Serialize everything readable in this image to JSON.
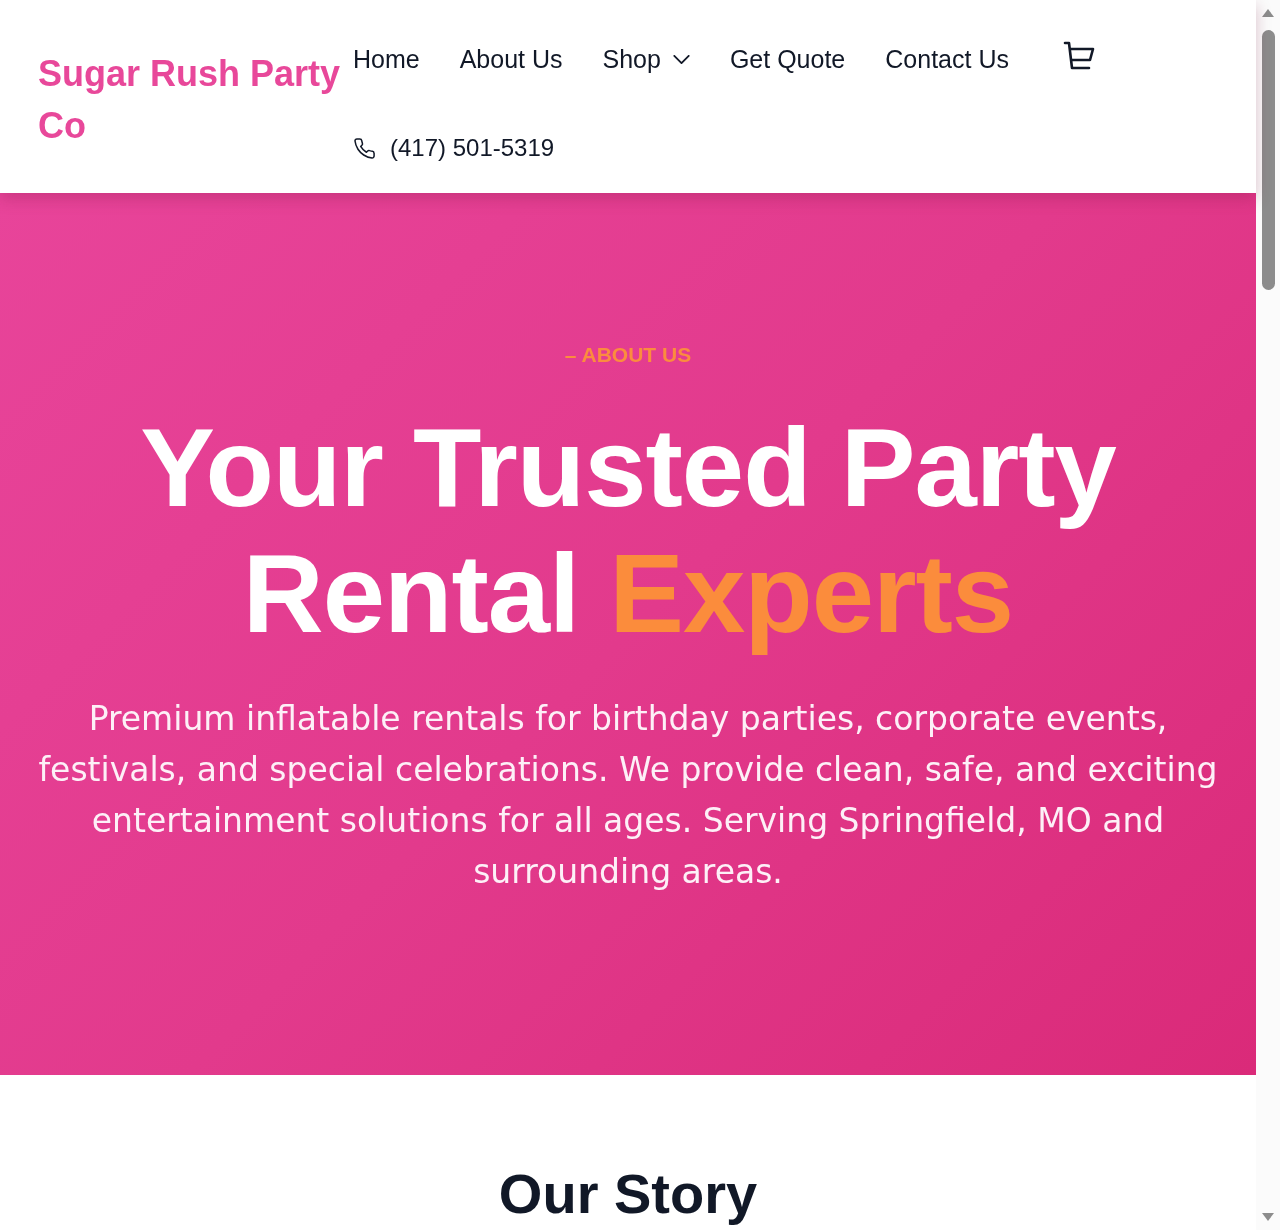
{
  "header": {
    "logo": "Sugar Rush Party Co",
    "nav": [
      {
        "label": "Home",
        "kind": "link"
      },
      {
        "label": "About Us",
        "kind": "link"
      },
      {
        "label": "Shop",
        "kind": "dropdown"
      },
      {
        "label": "Get Quote",
        "kind": "link"
      },
      {
        "label": "Contact Us",
        "kind": "link"
      }
    ],
    "phone": "(417) 501-5319"
  },
  "hero": {
    "eyebrow": "– ABOUT US",
    "heading": [
      {
        "text": "Your Trusted Party Rental ",
        "highlight": false
      },
      {
        "text": "Experts",
        "highlight": true
      }
    ],
    "description": "Premium inflatable rentals for birthday parties, corporate events, festivals, and special celebrations. We provide clean, safe, and exciting entertainment solutions for all ages. Serving Springfield, MO and surrounding areas."
  },
  "story": {
    "heading": "Our Story"
  }
}
